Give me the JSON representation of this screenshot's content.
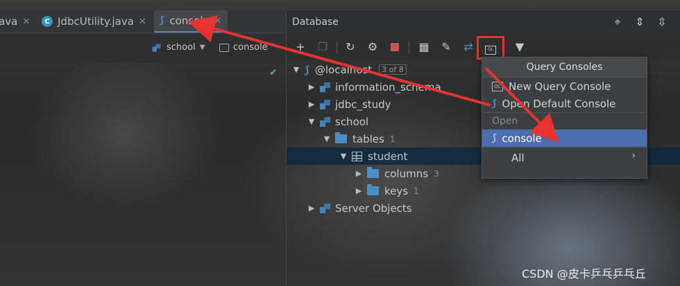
{
  "editor": {
    "tabs": [
      {
        "label": "ava",
        "icon": "java-file-icon"
      },
      {
        "label": "JdbcUtility.java",
        "icon": "class-c-icon"
      },
      {
        "label": "console",
        "icon": "mysql-console-icon"
      }
    ],
    "tab_close": "✕",
    "schema_chip": "school",
    "console_chip": "console",
    "status_check": "✔"
  },
  "database": {
    "title": "Database",
    "tree": {
      "root": {
        "label": "@localhost",
        "badge": "3 of 8"
      },
      "schemas": [
        {
          "label": "information_schema"
        },
        {
          "label": "jdbc_study"
        },
        {
          "label": "school"
        }
      ],
      "tables_folder": {
        "label": "tables",
        "count": "1"
      },
      "table": {
        "label": "student"
      },
      "columns": {
        "label": "columns",
        "count": "3"
      },
      "keys": {
        "label": "keys",
        "count": "1"
      },
      "server_objects": {
        "label": "Server Objects"
      }
    }
  },
  "popup": {
    "title": "Query Consoles",
    "items": [
      {
        "label": "New Query Console",
        "icon": "ql-icon"
      },
      {
        "label": "Open Default Console",
        "icon": "mysql-icon"
      }
    ],
    "group_label": "Open",
    "selected_item": {
      "label": "console"
    },
    "all_label": "All"
  },
  "watermark": "CSDN @皮卡乒乓乒乓丘",
  "colors": {
    "annotation_red": "#e8322f",
    "selection_blue": "#4b6eaf",
    "accent": "#4a8ec5"
  }
}
